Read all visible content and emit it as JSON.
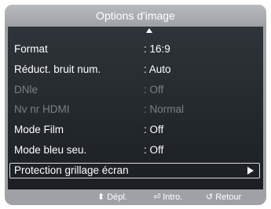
{
  "menu": {
    "title": "Options d'image",
    "items": [
      {
        "label": "Format",
        "value": ": 16:9"
      },
      {
        "label": "Réduct. bruit num.",
        "value": ": Auto"
      },
      {
        "label": "DNle",
        "value": ": Off"
      },
      {
        "label": "Nv nr HDMI",
        "value": ": Normal"
      },
      {
        "label": "Mode Film",
        "value": ": Off"
      },
      {
        "label": "Mode bleu seu.",
        "value": ": Off"
      },
      {
        "label": "Protection grillage écran"
      }
    ]
  },
  "footer": {
    "move": {
      "glyph": "⬍",
      "label": "Dépl."
    },
    "enter": {
      "glyph": "⏎",
      "label": "Intro."
    },
    "back": {
      "glyph": "↺",
      "label": "Retour"
    }
  },
  "colors": {
    "frame": "#9ea2a7",
    "panel": "#23282d",
    "disabled_text": "#7a8086",
    "text": "#ffffff"
  },
  "icons": {
    "scroll_up": "triangle-up",
    "submenu": "triangle-right",
    "move": "up-down-arrows",
    "enter": "enter",
    "back": "return"
  }
}
